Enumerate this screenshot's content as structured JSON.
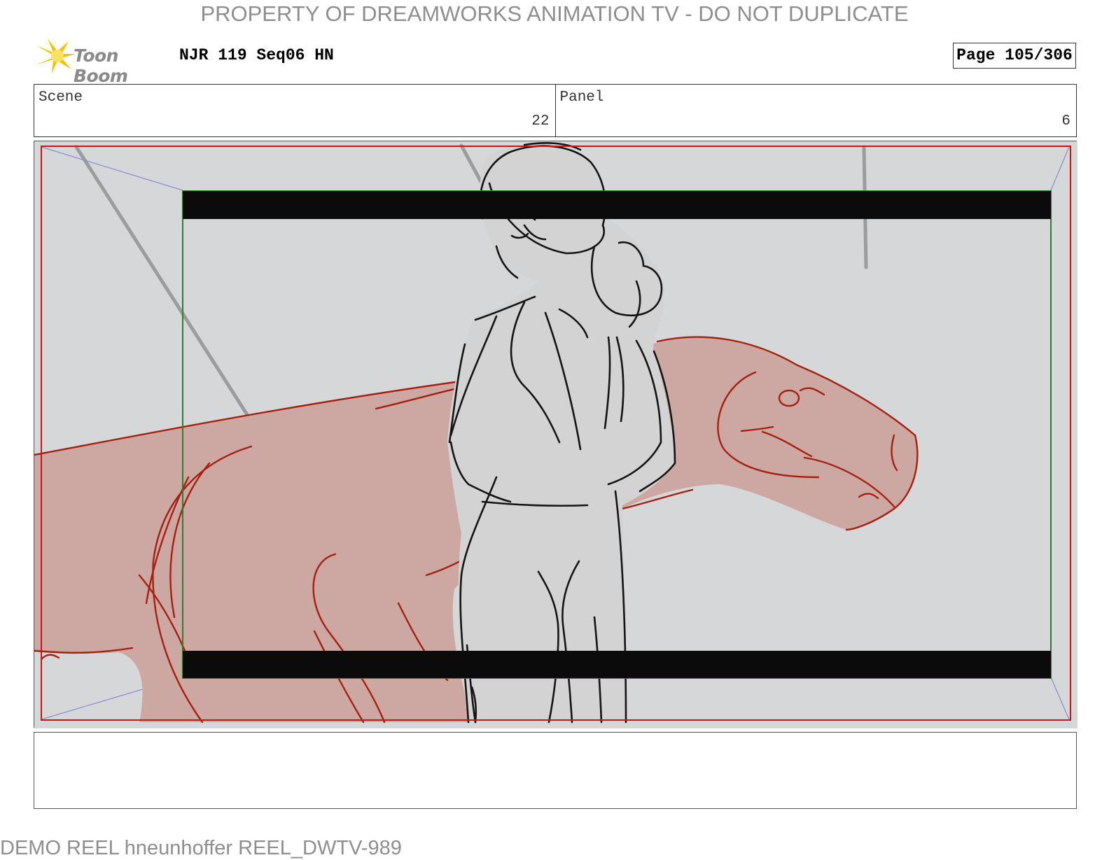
{
  "watermark": "PROPERTY OF DREAMWORKS ANIMATION TV - DO NOT DUPLICATE",
  "header": {
    "logo_text": "Toon Boom",
    "title": "NJR 119 Seq06 HN",
    "page": "Page 105/306"
  },
  "info": {
    "scene_label": "Scene",
    "scene_value": "22",
    "panel_label": "Panel",
    "panel_value": "6"
  },
  "footer": "DEMO REEL hneunhoffer REEL_DWTV-989",
  "colors": {
    "background": "#d6d7d8",
    "dino_fill": "#cda8a3",
    "dino_line": "#a5200f",
    "safe_frame": "#c0191b",
    "camera_frame": "#2a7f2a",
    "letterbox": "#0b0b0b",
    "perspective": "#8d8fd6"
  }
}
